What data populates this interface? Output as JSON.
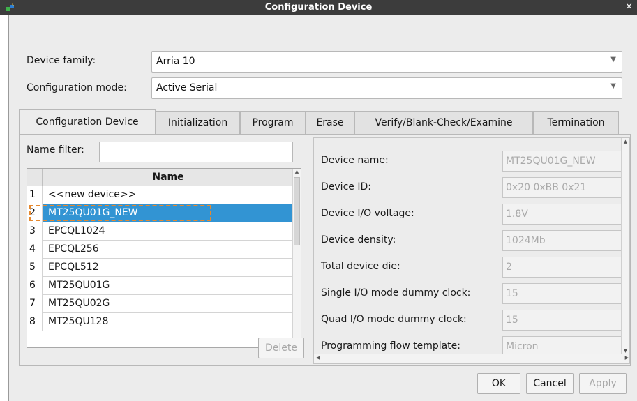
{
  "window": {
    "title": "Configuration Device",
    "close_symbol": "×"
  },
  "form": {
    "device_family_label": "Device family:",
    "device_family_value": "Arria 10",
    "config_mode_label": "Configuration mode:",
    "config_mode_value": "Active Serial"
  },
  "tabs": [
    {
      "label": "Configuration Device",
      "active": true
    },
    {
      "label": "Initialization",
      "active": false
    },
    {
      "label": "Program",
      "active": false
    },
    {
      "label": "Erase",
      "active": false
    },
    {
      "label": "Verify/Blank-Check/Examine",
      "active": false
    },
    {
      "label": "Termination",
      "active": false
    }
  ],
  "device_list": {
    "filter_label": "Name filter:",
    "filter_value": "",
    "column_header": "Name",
    "rows": [
      {
        "num": "1",
        "name": "<<new device>>"
      },
      {
        "num": "2",
        "name": "MT25QU01G_NEW",
        "selected": true
      },
      {
        "num": "3",
        "name": "EPCQL1024"
      },
      {
        "num": "4",
        "name": "EPCQL256"
      },
      {
        "num": "5",
        "name": "EPCQL512"
      },
      {
        "num": "6",
        "name": "MT25QU01G"
      },
      {
        "num": "7",
        "name": "MT25QU02G"
      },
      {
        "num": "8",
        "name": "MT25QU128"
      }
    ],
    "delete_label": "Delete"
  },
  "properties": [
    {
      "label": "Device name:",
      "value": "MT25QU01G_NEW"
    },
    {
      "label": "Device ID:",
      "value": "0x20 0xBB 0x21"
    },
    {
      "label": "Device I/O voltage:",
      "value": "1.8V"
    },
    {
      "label": "Device density:",
      "value": "1024Mb"
    },
    {
      "label": "Total device die:",
      "value": "2"
    },
    {
      "label": "Single I/O mode dummy clock:",
      "value": "15"
    },
    {
      "label": "Quad I/O mode dummy clock:",
      "value": "15"
    },
    {
      "label": "Programming flow template:",
      "value": "Micron"
    }
  ],
  "buttons": {
    "ok": "OK",
    "cancel": "Cancel",
    "apply": "Apply"
  },
  "colors": {
    "selection": "#3294d3",
    "focus_outline": "#e6892f",
    "titlebar": "#3c3c3c"
  }
}
